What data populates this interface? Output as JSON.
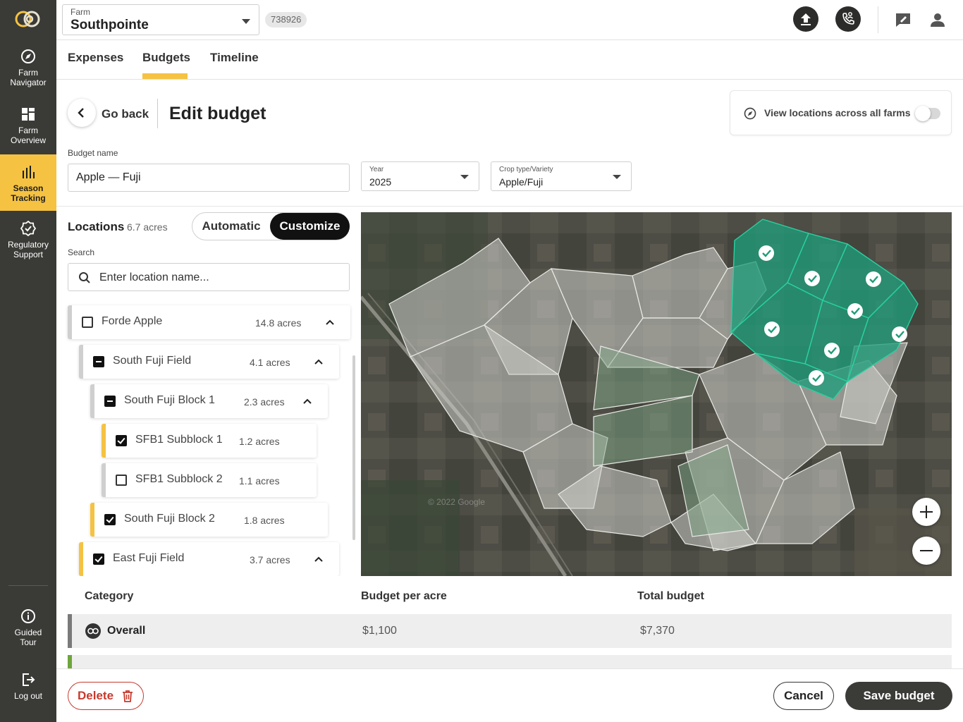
{
  "app": {
    "colors": {
      "accent": "#f5c242",
      "sidebar": "#3a3a37",
      "danger": "#c63a2e",
      "selected_field": "#1f9c7a"
    }
  },
  "sidebar": {
    "items": [
      {
        "label_1": "Farm",
        "label_2": "Navigator",
        "icon": "compass-icon",
        "active": false
      },
      {
        "label_1": "Farm",
        "label_2": "Overview",
        "icon": "dashboard-icon",
        "active": false
      },
      {
        "label_1": "Season",
        "label_2": "Tracking",
        "icon": "bar-chart-icon",
        "active": true
      },
      {
        "label_1": "Regulatory",
        "label_2": "Support",
        "icon": "badge-check-icon",
        "active": false
      }
    ],
    "bottom": [
      {
        "label_1": "Guided",
        "label_2": "Tour",
        "icon": "info-icon"
      },
      {
        "label_1": "Log out",
        "label_2": "",
        "icon": "logout-icon"
      }
    ]
  },
  "topbar": {
    "farm_label": "Farm",
    "farm_value": "Southpointe",
    "farm_id": "738926",
    "icons": [
      "upload-icon",
      "phone-support-icon",
      "feedback-icon",
      "user-icon"
    ]
  },
  "tabs": [
    "Expenses",
    "Budgets",
    "Timeline"
  ],
  "header": {
    "back_label": "Go back",
    "title": "Edit budget",
    "view_all_label": "View locations across all farms",
    "view_all_enabled": false
  },
  "form": {
    "budget_name_label": "Budget name",
    "budget_name_value": "Apple — Fuji",
    "year_label": "Year",
    "year_value": "2025",
    "crop_label": "Crop type/Variety",
    "crop_value": "Apple/Fuji"
  },
  "locations": {
    "title": "Locations",
    "total_acres": "6.7 acres",
    "mode_auto": "Automatic",
    "mode_custom": "Customize",
    "search_label": "Search",
    "search_placeholder": "Enter location name...",
    "rows": [
      {
        "name": "Forde Apple",
        "acres": "14.8 acres",
        "state": "unchecked",
        "expanded": true
      },
      {
        "name": "South Fuji Field",
        "acres": "4.1 acres",
        "state": "partial",
        "expanded": true
      },
      {
        "name": "South Fuji Block 1",
        "acres": "2.3 acres",
        "state": "partial",
        "expanded": true
      },
      {
        "name": "SFB1 Subblock 1",
        "acres": "1.2 acres",
        "state": "checked"
      },
      {
        "name": "SFB1 Subblock 2",
        "acres": "1.1 acres",
        "state": "unchecked"
      },
      {
        "name": "South Fuji Block 2",
        "acres": "1.8 acres",
        "state": "checked"
      },
      {
        "name": "East Fuji Field",
        "acres": "3.7 acres",
        "state": "checked",
        "expanded": true
      }
    ]
  },
  "map": {
    "zoom_in": "+",
    "zoom_out": "−",
    "watermark": "© 2022 Google"
  },
  "budget_table": {
    "headers": [
      "Category",
      "Budget per acre",
      "Total budget"
    ],
    "rows": [
      {
        "category": "Overall",
        "per_acre": "$1,100",
        "total": "$7,370"
      }
    ]
  },
  "footer": {
    "delete_label": "Delete",
    "cancel_label": "Cancel",
    "save_label": "Save budget"
  }
}
